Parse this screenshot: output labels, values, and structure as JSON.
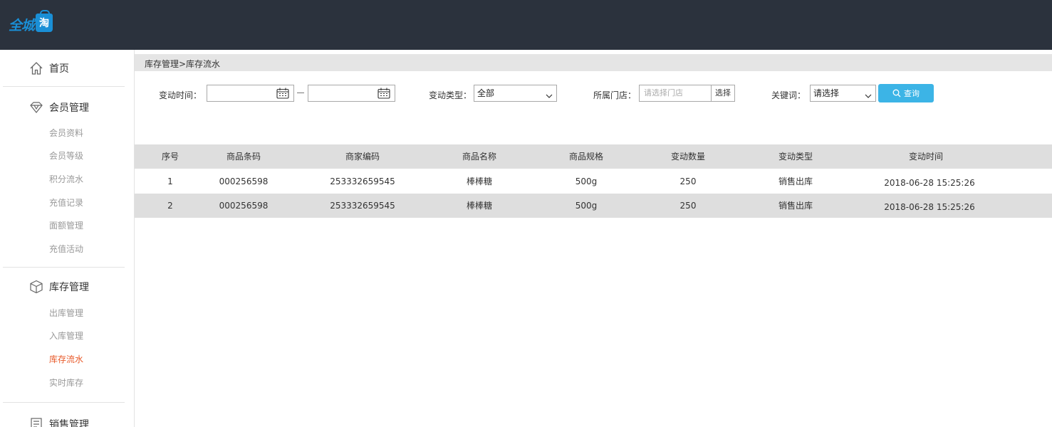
{
  "logo": {
    "text": "全城",
    "bag_char": "淘"
  },
  "sidebar": {
    "home": "首页",
    "groups": [
      {
        "title": "会员管理",
        "icon": "diamond-icon",
        "items": [
          "会员资料",
          "会员等级",
          "积分流水",
          "充值记录",
          "面额管理",
          "充值活动"
        ]
      },
      {
        "title": "库存管理",
        "icon": "box-icon",
        "items": [
          "出库管理",
          "入库管理",
          "库存流水",
          "实时库存"
        ],
        "active": "库存流水"
      },
      {
        "title": "销售管理",
        "icon": "list-icon",
        "items": []
      }
    ]
  },
  "breadcrumb": "库存管理>库存流水",
  "filters": {
    "change_time_label": "变动时间：",
    "start_date": "",
    "end_date": "",
    "change_type_label": "变动类型：",
    "change_type_value": "全部",
    "store_label": "所属门店：",
    "store_placeholder": "请选择门店",
    "store_button": "选择",
    "keyword_label": "关键词：",
    "keyword_value": "请选择",
    "query_button": "查询"
  },
  "table": {
    "headers": [
      "序号",
      "商品条码",
      "商家编码",
      "商品名称",
      "商品规格",
      "变动数量",
      "变动类型",
      "变动时间"
    ],
    "rows": [
      [
        "1",
        "000256598",
        "253332659545",
        "棒棒糖",
        "500g",
        "250",
        "销售出库",
        "2018-06-28 15:25:26"
      ],
      [
        "2",
        "000256598",
        "253332659545",
        "棒棒糖",
        "500g",
        "250",
        "销售出库",
        "2018-06-28 15:25:26"
      ]
    ]
  },
  "colors": {
    "header_bg": "#2b323d",
    "accent": "#3cb4e6",
    "active_nav": "#e85a2a",
    "logo": "#1a8fd6"
  }
}
